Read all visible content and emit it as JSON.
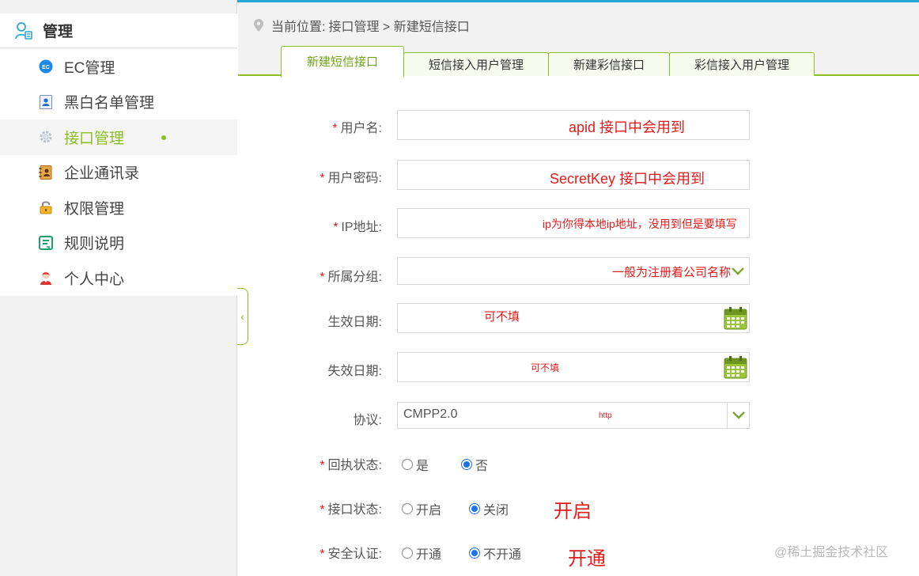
{
  "sidebar": {
    "header": {
      "label": "管理",
      "icon": "user-manage-icon"
    },
    "items": [
      {
        "label": "EC管理",
        "icon": "ec-icon",
        "active": false
      },
      {
        "label": "黑白名单管理",
        "icon": "contact-card-icon",
        "active": false
      },
      {
        "label": "接口管理",
        "icon": "gear-icon",
        "active": true
      },
      {
        "label": "企业通讯录",
        "icon": "address-book-icon",
        "active": false
      },
      {
        "label": "权限管理",
        "icon": "lock-icon",
        "active": false
      },
      {
        "label": "规则说明",
        "icon": "document-icon",
        "active": false
      },
      {
        "label": "个人中心",
        "icon": "person-icon",
        "active": false
      }
    ]
  },
  "breadcrumb": {
    "prefix": "当前位置:",
    "path": "接口管理 > 新建短信接口"
  },
  "tabs": [
    {
      "label": "新建短信接口",
      "active": true
    },
    {
      "label": "短信接入用户管理",
      "active": false
    },
    {
      "label": "新建彩信接口",
      "active": false
    },
    {
      "label": "彩信接入用户管理",
      "active": false
    }
  ],
  "form": {
    "username": {
      "label": "用户名:",
      "required": "*",
      "value": "",
      "note": "apid  接口中会用到"
    },
    "password": {
      "label": "用户密码:",
      "required": "*",
      "value": "",
      "note": "SecretKey 接口中会用到"
    },
    "ip": {
      "label": "IP地址:",
      "required": "*",
      "value": "",
      "note": "ip为你得本地ip地址，没用到但是要填写"
    },
    "group": {
      "label": "所属分组:",
      "required": "*",
      "value": "",
      "note": "一般为注册着公司名称"
    },
    "start_date": {
      "label": "生效日期:",
      "value": "",
      "note": "可不填"
    },
    "end_date": {
      "label": "失效日期:",
      "value": "",
      "note": "可不填"
    },
    "protocol": {
      "label": "协议:",
      "value": "CMPP2.0",
      "note": "http"
    },
    "receipt_status": {
      "label": "回执状态:",
      "required": "*",
      "options": [
        "是",
        "否"
      ],
      "selected": "否"
    },
    "api_status": {
      "label": "接口状态:",
      "required": "*",
      "options": [
        "开启",
        "关闭"
      ],
      "selected": "关闭",
      "note": "开启"
    },
    "security_auth": {
      "label": "安全认证:",
      "required": "*",
      "options": [
        "开通",
        "不开通"
      ],
      "selected": "不开通",
      "note": "开通"
    }
  },
  "watermark": "@稀土掘金技术社区",
  "colors": {
    "accent": "#8cbf26",
    "annotation": "#e31b1b",
    "radio": "#1a73e8",
    "top_line": "#27a6d9"
  }
}
